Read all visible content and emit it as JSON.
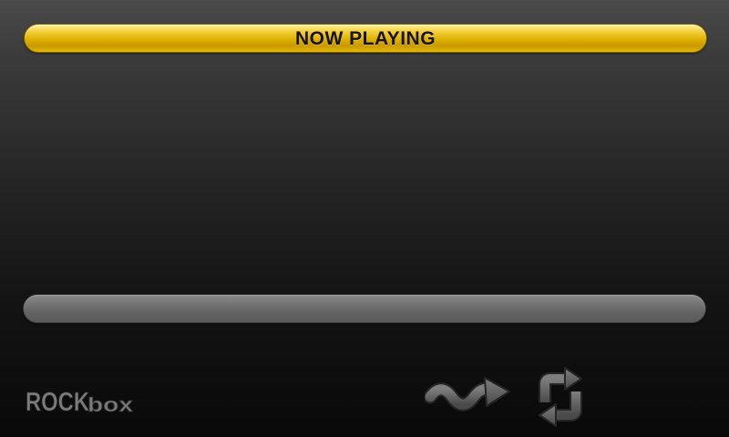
{
  "header": {
    "title": "NOW PLAYING"
  },
  "track": {
    "title": "",
    "artist": "",
    "album": ""
  },
  "progress": {
    "fraction": 0
  },
  "logo": {
    "text_rock": "ROCK",
    "text_box": "box"
  },
  "controls": {
    "shuffle_icon": "shuffle-icon",
    "repeat_icon": "repeat-icon"
  },
  "colors": {
    "accent": "#e0b400",
    "bar_gray": "#6e6e6e",
    "icon_gray": "#6a6a6a",
    "background_top": "#4b4b4b",
    "background_bottom": "#090909"
  }
}
